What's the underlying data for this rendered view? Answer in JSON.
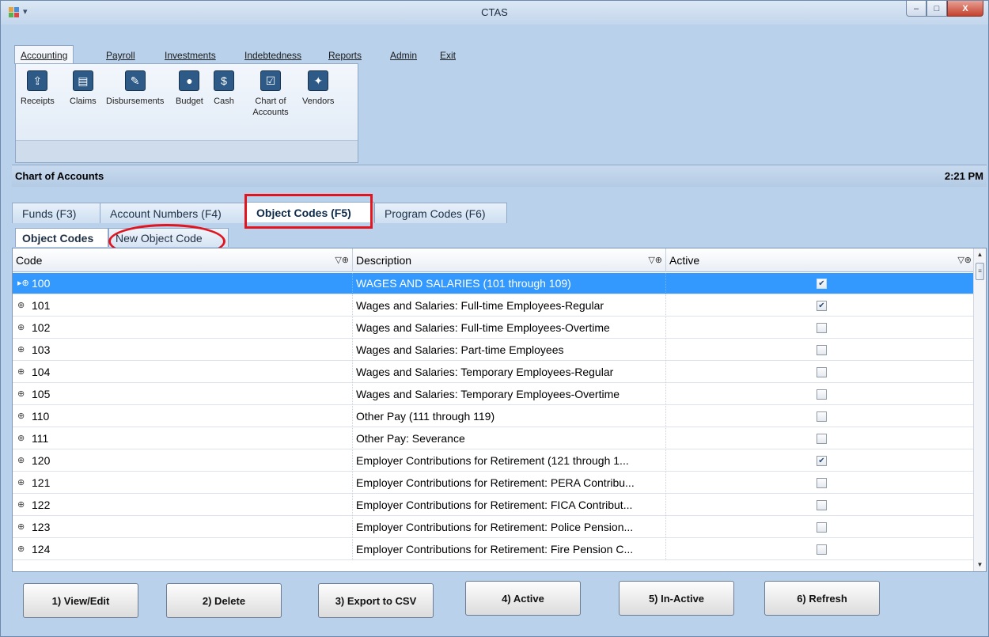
{
  "window": {
    "title": "CTAS",
    "controls": {
      "minimize": "–",
      "maximize": "□",
      "close": "X"
    }
  },
  "ribbon": {
    "tabs": [
      "Accounting",
      "Payroll",
      "Investments",
      "Indebtedness",
      "Reports",
      "Admin",
      "Exit"
    ],
    "buttons": [
      {
        "label": "Receipts",
        "icon": "receipts-icon",
        "glyph": "⇪"
      },
      {
        "label": "Claims",
        "icon": "claims-icon",
        "glyph": "▤"
      },
      {
        "label": "Disbursements",
        "icon": "disbursements-icon",
        "glyph": "✎"
      },
      {
        "label": "Budget",
        "icon": "budget-icon",
        "glyph": "●"
      },
      {
        "label": "Cash",
        "icon": "cash-icon",
        "glyph": "$"
      },
      {
        "label": "Chart of Accounts",
        "icon": "chart-of-accounts-icon",
        "glyph": "☑"
      },
      {
        "label": "Vendors",
        "icon": "vendors-icon",
        "glyph": "✦"
      }
    ]
  },
  "header": {
    "title": "Chart of Accounts",
    "time": "2:21 PM"
  },
  "tabs": [
    "Funds (F3)",
    "Account Numbers (F4)",
    "Object Codes (F5)",
    "Program Codes (F6)"
  ],
  "subtabs": [
    "Object Codes",
    "New Object Code"
  ],
  "grid": {
    "columns": [
      "Code",
      "Description",
      "Active"
    ],
    "filter_icon": "▽⊕",
    "rows": [
      {
        "code": "100",
        "description": "WAGES AND SALARIES (101 through 109)",
        "active": true
      },
      {
        "code": "101",
        "description": "Wages and Salaries: Full-time Employees-Regular",
        "active": true
      },
      {
        "code": "102",
        "description": "Wages and Salaries: Full-time Employees-Overtime",
        "active": false
      },
      {
        "code": "103",
        "description": "Wages and Salaries: Part-time Employees",
        "active": false
      },
      {
        "code": "104",
        "description": "Wages and Salaries: Temporary Employees-Regular",
        "active": false
      },
      {
        "code": "105",
        "description": "Wages and Salaries: Temporary Employees-Overtime",
        "active": false
      },
      {
        "code": "110",
        "description": "Other Pay (111 through 119)",
        "active": false
      },
      {
        "code": "111",
        "description": "Other Pay: Severance",
        "active": false
      },
      {
        "code": "120",
        "description": "Employer Contributions for Retirement (121 through 1...",
        "active": true
      },
      {
        "code": "121",
        "description": "Employer Contributions for Retirement: PERA Contribu...",
        "active": false
      },
      {
        "code": "122",
        "description": "Employer Contributions for Retirement: FICA Contribut...",
        "active": false
      },
      {
        "code": "123",
        "description": "Employer Contributions for Retirement: Police Pension...",
        "active": false
      },
      {
        "code": "124",
        "description": "Employer Contributions for Retirement: Fire Pension C...",
        "active": false
      }
    ]
  },
  "buttons": [
    "1) View/Edit",
    "2) Delete",
    "3) Export to CSV",
    "4) Active",
    "5) In-Active",
    "6) Refresh"
  ]
}
